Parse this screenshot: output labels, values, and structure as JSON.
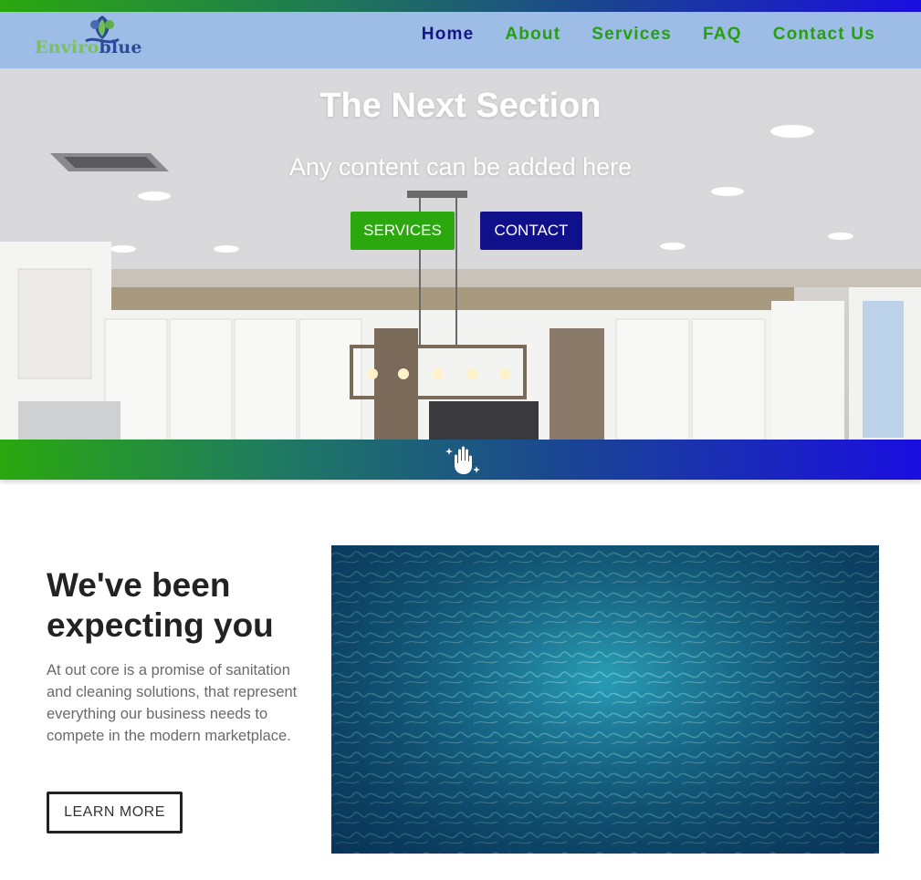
{
  "header": {
    "logo": {
      "text_green": "Enviro",
      "text_blue": "blue"
    },
    "nav": [
      {
        "label": "Home",
        "active": true
      },
      {
        "label": "About",
        "active": false
      },
      {
        "label": "Services",
        "active": false
      },
      {
        "label": "FAQ",
        "active": false
      },
      {
        "label": "Contact Us",
        "active": false
      }
    ]
  },
  "hero": {
    "title": "The Next Section",
    "subtitle": "Any content can be added here",
    "services_button": "SERVICES",
    "contact_button": "CONTACT"
  },
  "band": {
    "icon": "sparkle-hand-icon"
  },
  "intro": {
    "heading": "We've been expecting you",
    "text": "At out core is a promise of sanitation and cleaning solutions, that represent everything our business needs to compete in the modern marketplace.",
    "button": "LEARN MORE"
  },
  "colors": {
    "brand_green": "#2aa80e",
    "brand_navy": "#10108a",
    "brand_blue": "#1a0ee0",
    "nav_background": "#9dbde6"
  }
}
